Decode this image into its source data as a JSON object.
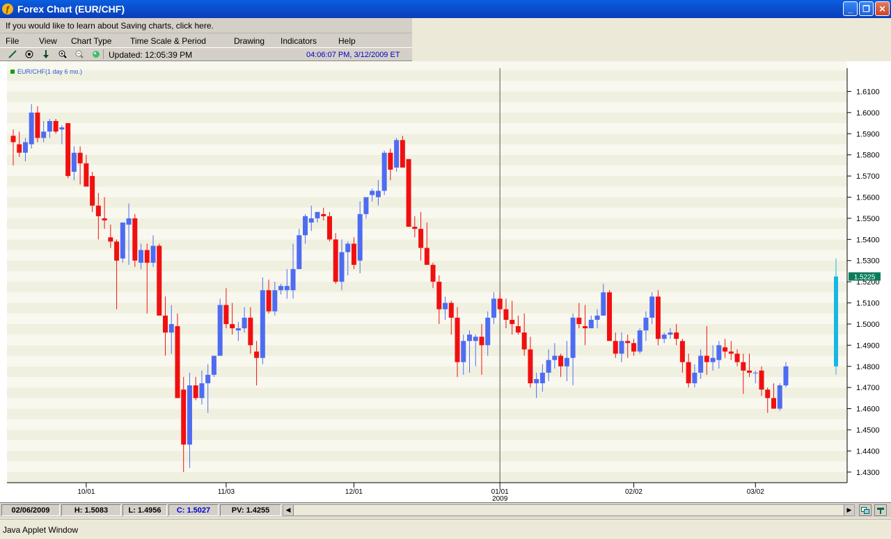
{
  "window": {
    "title": "Forex Chart (EUR/CHF)",
    "app_icon": "forex-app-icon",
    "min_icon": "minimize-icon",
    "max_icon": "maximize-icon",
    "close_icon": "close-icon"
  },
  "infobar": {
    "text": "If you would like to learn about Saving charts, click here."
  },
  "menu": {
    "items": [
      "File",
      "View",
      "Chart Type",
      "Time Scale & Period",
      "Drawing",
      "Indicators",
      "Help"
    ]
  },
  "toolbar": {
    "icons": [
      "trendline-icon",
      "crosshair-icon",
      "down-arrow-icon",
      "zoom-in-icon",
      "zoom-out-icon",
      "refresh-icon"
    ],
    "updated": "Updated: 12:05:39 PM",
    "timestamp": "04:06:07 PM, 3/12/2009 ET"
  },
  "chart_data": {
    "type": "candlestick",
    "legend": "EUR/CHF(1 day 6 mo.)",
    "up_color": "#4e6cf2",
    "down_color": "#f01010",
    "ylim": [
      1.425,
      1.621
    ],
    "y_ticks": [
      "1.6100",
      "1.6000",
      "1.5900",
      "1.5800",
      "1.5700",
      "1.5600",
      "1.5500",
      "1.5400",
      "1.5300",
      "1.5200",
      "1.5100",
      "1.5000",
      "1.4900",
      "1.4800",
      "1.4700",
      "1.4600",
      "1.4500",
      "1.4400",
      "1.4300"
    ],
    "x_ticks": [
      {
        "label": "10/01",
        "index": 12
      },
      {
        "label": "11/03",
        "index": 35
      },
      {
        "label": "12/01",
        "index": 56
      },
      {
        "label": "01/01",
        "sub": "2009",
        "index": 80
      },
      {
        "label": "02/02",
        "index": 102
      },
      {
        "label": "03/02",
        "index": 122
      }
    ],
    "cursor_index": 80,
    "last_price": "1.5225",
    "last_bar": {
      "open": 1.48,
      "high": 1.531,
      "low": 1.476,
      "close": 1.5225
    },
    "ohlc": [
      [
        1.589,
        1.592,
        1.575,
        1.586
      ],
      [
        1.585,
        1.591,
        1.579,
        1.581
      ],
      [
        1.581,
        1.588,
        1.577,
        1.586
      ],
      [
        1.585,
        1.604,
        1.583,
        1.6
      ],
      [
        1.6,
        1.603,
        1.586,
        1.588
      ],
      [
        1.588,
        1.596,
        1.586,
        1.591
      ],
      [
        1.591,
        1.597,
        1.588,
        1.596
      ],
      [
        1.596,
        1.597,
        1.59,
        1.591
      ],
      [
        1.592,
        1.594,
        1.585,
        1.593
      ],
      [
        1.595,
        1.595,
        1.569,
        1.57
      ],
      [
        1.572,
        1.584,
        1.568,
        1.581
      ],
      [
        1.581,
        1.584,
        1.566,
        1.576
      ],
      [
        1.576,
        1.58,
        1.569,
        1.565
      ],
      [
        1.57,
        1.572,
        1.553,
        1.556
      ],
      [
        1.556,
        1.562,
        1.54,
        1.551
      ],
      [
        1.55,
        1.56,
        1.545,
        1.549
      ],
      [
        1.541,
        1.547,
        1.536,
        1.539
      ],
      [
        1.539,
        1.54,
        1.507,
        1.53
      ],
      [
        1.531,
        1.548,
        1.529,
        1.548
      ],
      [
        1.547,
        1.557,
        1.528,
        1.55
      ],
      [
        1.55,
        1.552,
        1.527,
        1.53
      ],
      [
        1.529,
        1.538,
        1.526,
        1.535
      ],
      [
        1.535,
        1.538,
        1.505,
        1.529
      ],
      [
        1.529,
        1.542,
        1.527,
        1.537
      ],
      [
        1.537,
        1.538,
        1.519,
        1.504
      ],
      [
        1.504,
        1.513,
        1.485,
        1.496
      ],
      [
        1.496,
        1.509,
        1.486,
        1.5
      ],
      [
        1.499,
        1.505,
        1.465,
        1.465
      ],
      [
        1.469,
        1.475,
        1.43,
        1.443
      ],
      [
        1.443,
        1.477,
        1.432,
        1.471
      ],
      [
        1.471,
        1.475,
        1.464,
        1.465
      ],
      [
        1.465,
        1.478,
        1.462,
        1.472
      ],
      [
        1.472,
        1.481,
        1.458,
        1.476
      ],
      [
        1.476,
        1.485,
        1.475,
        1.485
      ],
      [
        1.485,
        1.512,
        1.485,
        1.509
      ],
      [
        1.509,
        1.517,
        1.498,
        1.5
      ],
      [
        1.5,
        1.51,
        1.495,
        1.498
      ],
      [
        1.497,
        1.501,
        1.492,
        1.498
      ],
      [
        1.498,
        1.508,
        1.496,
        1.503
      ],
      [
        1.503,
        1.508,
        1.486,
        1.49
      ],
      [
        1.487,
        1.492,
        1.471,
        1.484
      ],
      [
        1.484,
        1.522,
        1.481,
        1.516
      ],
      [
        1.516,
        1.521,
        1.505,
        1.506
      ],
      [
        1.506,
        1.52,
        1.504,
        1.516
      ],
      [
        1.516,
        1.519,
        1.514,
        1.518
      ],
      [
        1.516,
        1.526,
        1.512,
        1.518
      ],
      [
        1.516,
        1.538,
        1.512,
        1.526
      ],
      [
        1.526,
        1.545,
        1.526,
        1.542
      ],
      [
        1.542,
        1.552,
        1.538,
        1.551
      ],
      [
        1.548,
        1.556,
        1.544,
        1.55
      ],
      [
        1.55,
        1.553,
        1.548,
        1.553
      ],
      [
        1.552,
        1.555,
        1.549,
        1.551
      ],
      [
        1.551,
        1.553,
        1.539,
        1.54
      ],
      [
        1.54,
        1.543,
        1.519,
        1.52
      ],
      [
        1.52,
        1.54,
        1.516,
        1.534
      ],
      [
        1.534,
        1.539,
        1.523,
        1.538
      ],
      [
        1.538,
        1.541,
        1.526,
        1.528
      ],
      [
        1.53,
        1.558,
        1.524,
        1.552
      ],
      [
        1.552,
        1.56,
        1.55,
        1.56
      ],
      [
        1.561,
        1.564,
        1.558,
        1.563
      ],
      [
        1.56,
        1.568,
        1.556,
        1.563
      ],
      [
        1.563,
        1.582,
        1.561,
        1.581
      ],
      [
        1.581,
        1.583,
        1.568,
        1.573
      ],
      [
        1.574,
        1.588,
        1.572,
        1.587
      ],
      [
        1.587,
        1.589,
        1.578,
        1.574
      ],
      [
        1.578,
        1.578,
        1.552,
        1.546
      ],
      [
        1.546,
        1.551,
        1.541,
        1.545
      ],
      [
        1.545,
        1.553,
        1.53,
        1.536
      ],
      [
        1.536,
        1.548,
        1.533,
        1.528
      ],
      [
        1.528,
        1.529,
        1.517,
        1.52
      ],
      [
        1.52,
        1.523,
        1.5,
        1.507
      ],
      [
        1.507,
        1.513,
        1.502,
        1.51
      ],
      [
        1.51,
        1.511,
        1.495,
        1.503
      ],
      [
        1.503,
        1.508,
        1.475,
        1.482
      ],
      [
        1.482,
        1.495,
        1.476,
        1.492
      ],
      [
        1.492,
        1.497,
        1.477,
        1.495
      ],
      [
        1.492,
        1.495,
        1.48,
        1.494
      ],
      [
        1.494,
        1.5,
        1.476,
        1.49
      ],
      [
        1.49,
        1.506,
        1.485,
        1.503
      ],
      [
        1.503,
        1.515,
        1.5,
        1.512
      ],
      [
        1.512,
        1.515,
        1.505,
        1.507
      ],
      [
        1.507,
        1.512,
        1.498,
        1.502
      ],
      [
        1.502,
        1.511,
        1.495,
        1.5
      ],
      [
        1.499,
        1.504,
        1.495,
        1.496
      ],
      [
        1.496,
        1.505,
        1.485,
        1.488
      ],
      [
        1.488,
        1.494,
        1.47,
        1.472
      ],
      [
        1.472,
        1.477,
        1.465,
        1.474
      ],
      [
        1.472,
        1.481,
        1.468,
        1.477
      ],
      [
        1.477,
        1.488,
        1.473,
        1.483
      ],
      [
        1.483,
        1.491,
        1.479,
        1.485
      ],
      [
        1.485,
        1.486,
        1.475,
        1.48
      ],
      [
        1.48,
        1.492,
        1.473,
        1.484
      ],
      [
        1.484,
        1.505,
        1.471,
        1.503
      ],
      [
        1.503,
        1.51,
        1.498,
        1.5
      ],
      [
        1.499,
        1.509,
        1.49,
        1.498
      ],
      [
        1.498,
        1.504,
        1.498,
        1.502
      ],
      [
        1.502,
        1.507,
        1.498,
        1.504
      ],
      [
        1.504,
        1.519,
        1.504,
        1.515
      ],
      [
        1.515,
        1.516,
        1.496,
        1.492
      ],
      [
        1.492,
        1.496,
        1.484,
        1.486
      ],
      [
        1.486,
        1.496,
        1.482,
        1.492
      ],
      [
        1.492,
        1.495,
        1.484,
        1.491
      ],
      [
        1.491,
        1.493,
        1.485,
        1.487
      ],
      [
        1.487,
        1.498,
        1.486,
        1.497
      ],
      [
        1.497,
        1.506,
        1.492,
        1.503
      ],
      [
        1.503,
        1.515,
        1.5,
        1.513
      ],
      [
        1.513,
        1.516,
        1.49,
        1.493
      ],
      [
        1.493,
        1.496,
        1.491,
        1.495
      ],
      [
        1.495,
        1.498,
        1.493,
        1.496
      ],
      [
        1.496,
        1.5,
        1.49,
        1.493
      ],
      [
        1.492,
        1.493,
        1.477,
        1.482
      ],
      [
        1.482,
        1.486,
        1.47,
        1.472
      ],
      [
        1.472,
        1.481,
        1.47,
        1.477
      ],
      [
        1.477,
        1.488,
        1.474,
        1.485
      ],
      [
        1.485,
        1.499,
        1.476,
        1.482
      ],
      [
        1.482,
        1.49,
        1.478,
        1.484
      ],
      [
        1.483,
        1.492,
        1.479,
        1.49
      ],
      [
        1.489,
        1.493,
        1.484,
        1.487
      ],
      [
        1.487,
        1.492,
        1.483,
        1.486
      ],
      [
        1.486,
        1.488,
        1.48,
        1.482
      ],
      [
        1.482,
        1.486,
        1.467,
        1.478
      ],
      [
        1.478,
        1.486,
        1.475,
        1.477
      ],
      [
        1.477,
        1.478,
        1.472,
        1.477
      ],
      [
        1.478,
        1.48,
        1.466,
        1.469
      ],
      [
        1.469,
        1.47,
        1.458,
        1.465
      ],
      [
        1.465,
        1.472,
        1.46,
        1.46
      ],
      [
        1.46,
        1.472,
        1.459,
        1.471
      ],
      [
        1.471,
        1.482,
        1.47,
        1.48
      ]
    ]
  },
  "bottombar": {
    "date": "02/06/2009",
    "high": "H: 1.5083",
    "low": "L: 1.4956",
    "close": "C: 1.5027",
    "pv": "PV: 1.4255",
    "left_arrow": "scroll-left-icon",
    "right_arrow": "scroll-right-icon"
  },
  "statusbar": {
    "text": "Java Applet Window"
  }
}
